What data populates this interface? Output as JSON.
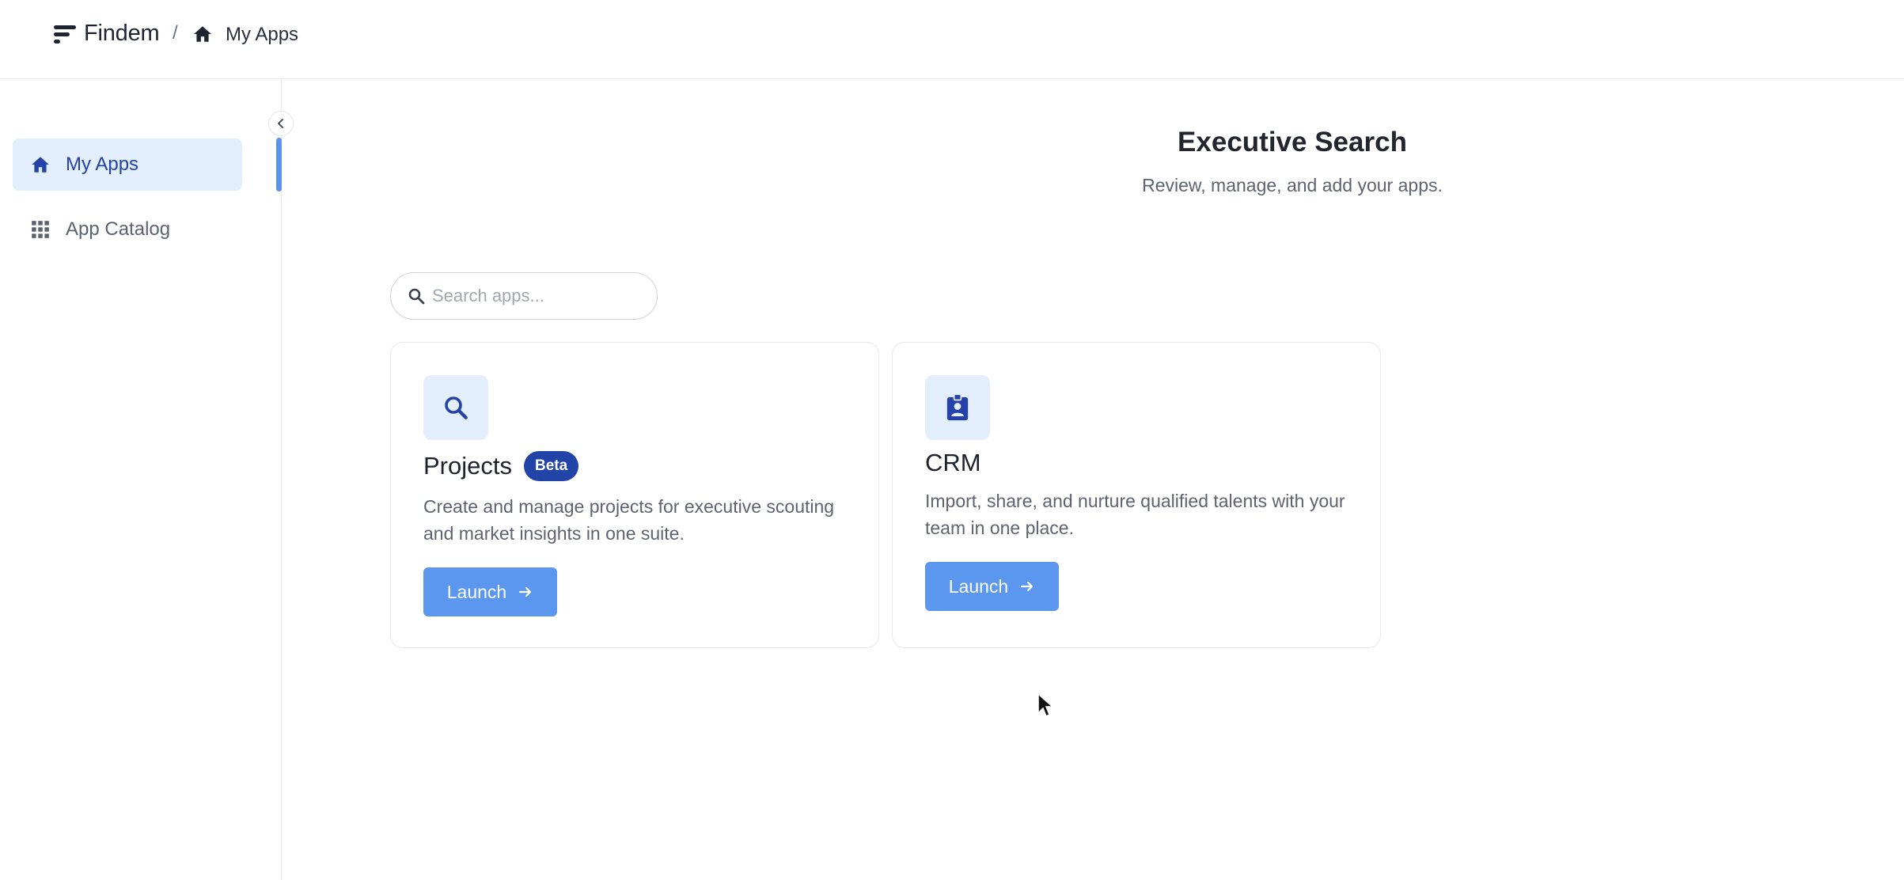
{
  "header": {
    "brand": "Findem",
    "separator": "/",
    "breadcrumb": "My Apps"
  },
  "sidebar": {
    "items": [
      {
        "label": "My Apps",
        "icon": "home-icon",
        "active": true
      },
      {
        "label": "App Catalog",
        "icon": "grid-icon",
        "active": false
      }
    ],
    "collapse_icon": "chevron-left-icon"
  },
  "main": {
    "title": "Executive Search",
    "subtitle": "Review, manage, and add your apps.",
    "search": {
      "placeholder": "Search apps...",
      "value": ""
    },
    "apps": [
      {
        "name": "Projects",
        "badge": "Beta",
        "icon": "search-icon",
        "description": "Create and manage projects for executive scouting and market insights in one suite.",
        "launch_label": "Launch"
      },
      {
        "name": "CRM",
        "icon": "badge-id-icon",
        "description": "Import, share, and nurture qualified talents with your team in one place.",
        "launch_label": "Launch"
      }
    ]
  },
  "colors": {
    "accent": "#5b97ef",
    "active_bg": "#e3eefe",
    "active_text": "#2442a8",
    "badge_bg": "#2243a8"
  }
}
